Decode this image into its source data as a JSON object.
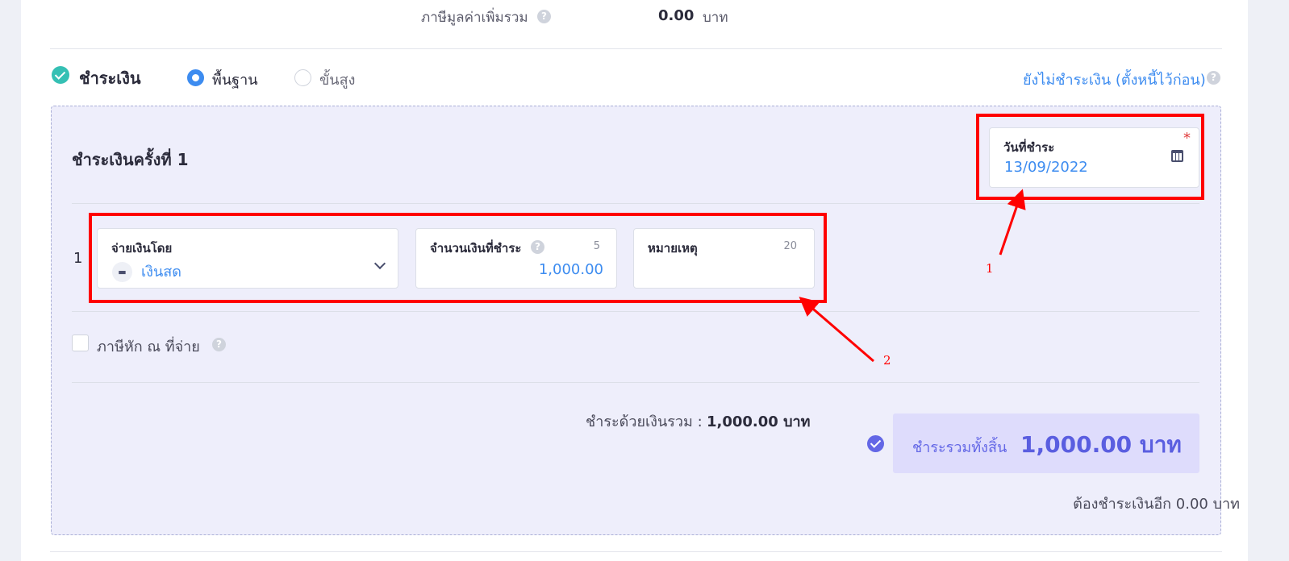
{
  "vat": {
    "label": "ภาษีมูลค่าเพิ่มรวม",
    "value": "0.00",
    "unit": "บาท"
  },
  "payment": {
    "title": "ชำระเงิน",
    "mode_options": [
      {
        "label": "พื้นฐาน",
        "selected": true
      },
      {
        "label": "ขั้นสูง",
        "selected": false
      }
    ],
    "unpaid_link": "ยังไม่ชำระเงิน (ตั้งหนี้ไว้ก่อน)"
  },
  "round": {
    "title": "ชำระเงินครั้งที่ 1",
    "date_label": "วันที่ชำระ",
    "date_value": "13/09/2022",
    "required_mark": "*"
  },
  "line": {
    "number": "1",
    "paid_by_label": "จ่ายเงินโดย",
    "paid_by_value": "เงินสด",
    "amount_label": "จำนวนเงินที่ชำระ",
    "amount_count": "5",
    "amount_value": "1,000.00",
    "note_label": "หมายเหตุ",
    "note_count": "20"
  },
  "withholding": {
    "label": "ภาษีหัก ณ ที่จ่าย",
    "checked": false
  },
  "summary": {
    "sum_label": "ชำระด้วยเงินรวม :",
    "sum_value": "1,000.00 บาท",
    "total_label": "ชำระรวมทั้งสิ้น",
    "total_value": "1,000.00 บาท",
    "remaining": "ต้องชำระเงินอีก 0.00 บาท"
  },
  "annotations": {
    "label_1": "1",
    "label_2": "2",
    "color": "#ff0000"
  },
  "icons": {
    "help": "question-circle-icon",
    "calendar": "calendar-icon",
    "cash": "cash-icon",
    "chevron": "chevron-down-icon",
    "check": "check-circle-icon"
  },
  "colors": {
    "accent_blue": "#3d8cf0",
    "teal_check": "#35c0b4",
    "purple": "#6367e6",
    "panel_bg": "#eeeefb"
  }
}
